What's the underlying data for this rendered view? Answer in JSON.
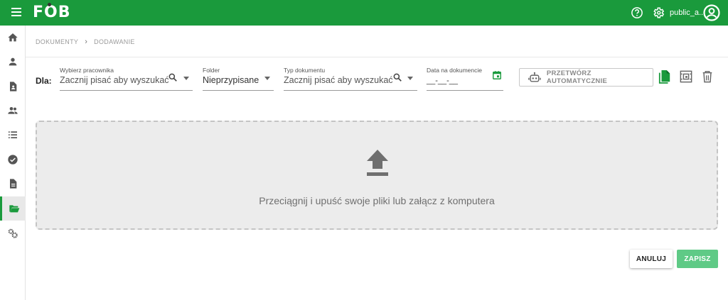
{
  "app": {
    "logo": "FOB",
    "username": "public_a..."
  },
  "topbar": {
    "icons": [
      "menu-icon",
      "help-icon",
      "gear-icon",
      "account-circle-icon"
    ]
  },
  "sidebar": {
    "items": [
      {
        "icon": "home-icon"
      },
      {
        "icon": "person-icon"
      },
      {
        "icon": "document-person-icon"
      },
      {
        "icon": "people-icon"
      },
      {
        "icon": "list-icon"
      },
      {
        "icon": "check-circle-icon"
      },
      {
        "icon": "document-icon"
      },
      {
        "icon": "folder-open-icon",
        "active": true
      },
      {
        "icon": "settings-gears-icon"
      }
    ],
    "accent": "#1a9a3c"
  },
  "breadcrumb": {
    "items": [
      "DOKUMENTY",
      "DODAWANIE"
    ]
  },
  "form": {
    "for_label": "Dla:",
    "employee": {
      "label": "Wybierz pracownika",
      "placeholder": "Zacznij pisać aby wyszukać"
    },
    "folder": {
      "label": "Folder",
      "value": "Nieprzypisane"
    },
    "doc_type": {
      "label": "Typ dokumentu",
      "placeholder": "Zacznij pisać aby wyszukać"
    },
    "date": {
      "label": "Data na dokumencie",
      "placeholder": "__-__-__"
    },
    "auto_button": "PRZETWÓRZ AUTOMATYCZNIE"
  },
  "dropzone": {
    "text": "Przeciągnij i upuść swoje pliki lub załącz z komputera"
  },
  "actions": {
    "cancel": "ANULUJ",
    "save": "ZAPISZ"
  },
  "colors": {
    "brand": "#1a9a3c",
    "save": "#5fca86",
    "dropzone_bg": "#ececec"
  }
}
